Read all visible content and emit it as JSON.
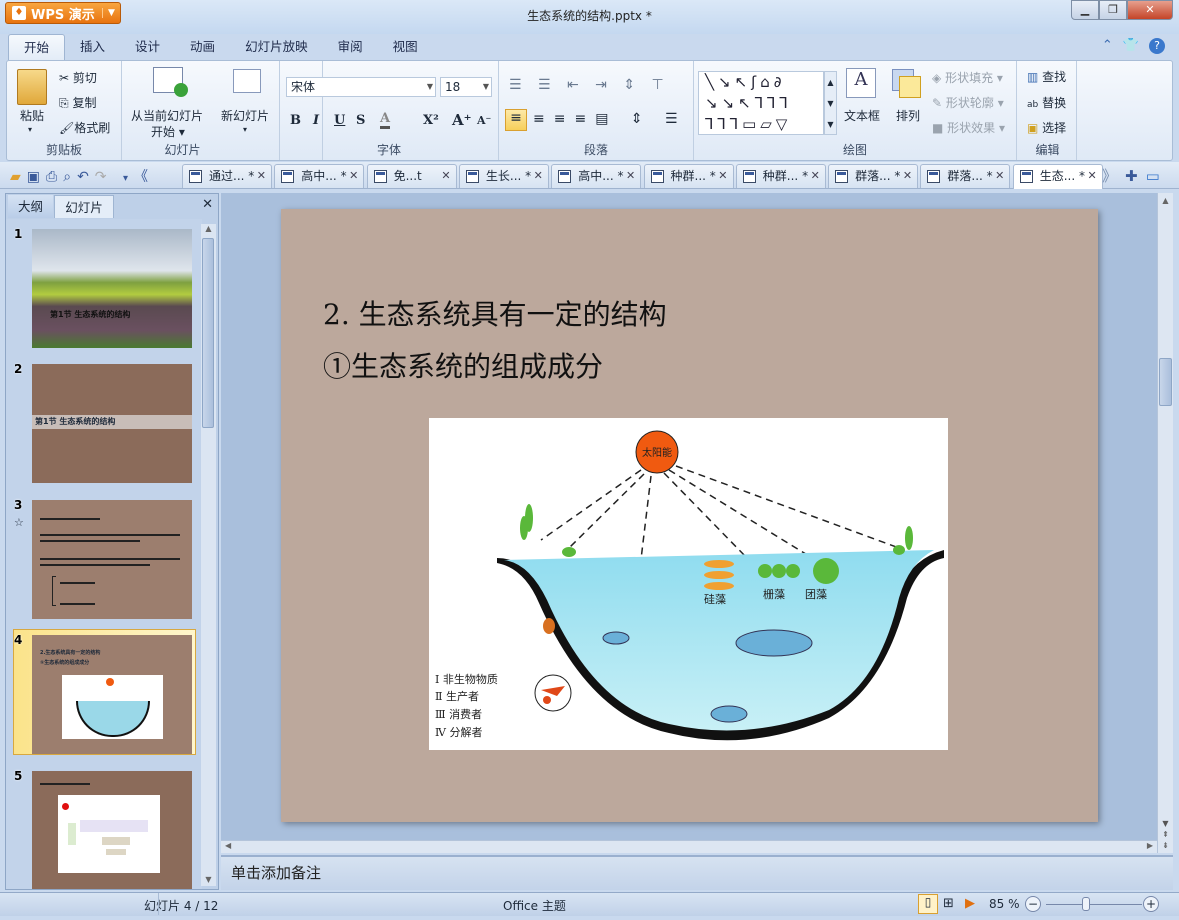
{
  "app": {
    "name": "WPS 演示",
    "doc_title": "生态系统的结构.pptx *"
  },
  "menu_tabs": [
    "开始",
    "插入",
    "设计",
    "动画",
    "幻灯片放映",
    "审阅",
    "视图"
  ],
  "ribbon": {
    "clipboard": {
      "label": "剪贴板",
      "paste": "粘贴",
      "cut": "剪切",
      "copy": "复制",
      "format_painter": "格式刷"
    },
    "slides": {
      "label": "幻灯片",
      "from_current_1": "从当前幻灯片",
      "from_current_2": "开始",
      "new_slide": "新幻灯片"
    },
    "font": {
      "label": "字体",
      "font_name": "宋体",
      "font_size": "18",
      "bold": "B",
      "italic": "I",
      "underline": "U",
      "strike": "S",
      "color": "A",
      "superscript": "X²",
      "grow": "A⁺",
      "shrink": "A⁻"
    },
    "paragraph": {
      "label": "段落"
    },
    "drawing": {
      "label": "绘图",
      "textbox": "文本框",
      "arrange": "排列",
      "shape_fill": "形状填充",
      "shape_outline": "形状轮廓",
      "shape_effect": "形状效果"
    },
    "edit": {
      "label": "编辑",
      "find": "查找",
      "replace": "替换",
      "select": "选择"
    }
  },
  "doc_tabs": [
    {
      "label": "通过...",
      "modified": "*"
    },
    {
      "label": "高中...",
      "modified": "*"
    },
    {
      "label": "免...t",
      "modified": ""
    },
    {
      "label": "生长...",
      "modified": "*"
    },
    {
      "label": "高中...",
      "modified": "*"
    },
    {
      "label": "种群...",
      "modified": "*"
    },
    {
      "label": "种群...",
      "modified": "*"
    },
    {
      "label": "群落...",
      "modified": "*"
    },
    {
      "label": "群落...",
      "modified": "*"
    },
    {
      "label": "生态...",
      "modified": "*",
      "active": true
    }
  ],
  "left_panel": {
    "tabs": [
      "大纲",
      "幻灯片"
    ],
    "active_tab": "幻灯片",
    "thumbnails": [
      {
        "num": "1",
        "title": "第1节 生态系统的结构"
      },
      {
        "num": "2",
        "title": "第1节  生态系统的结构"
      },
      {
        "num": "3",
        "title": ""
      },
      {
        "num": "4",
        "title": "2.生态系统具有一定的结构",
        "subtitle": "①生态系统的组成成分",
        "selected": true
      },
      {
        "num": "5",
        "title": ""
      }
    ]
  },
  "slide": {
    "title1": "2. 生态系统具有一定的结构",
    "title2": "①生态系统的组成成分",
    "figure": {
      "sun": "太阳能",
      "algae": [
        "硅藻",
        "栅藻",
        "团藻"
      ],
      "legend": [
        "Ⅰ 非生物物质",
        "Ⅱ 生产者",
        "Ⅲ 消费者",
        "Ⅳ 分解者"
      ]
    }
  },
  "notes_placeholder": "单击添加备注",
  "status": {
    "slide_pos": "幻灯片 4 / 12",
    "theme": "Office 主题",
    "zoom": "85 %",
    "zoom_percent": 85
  },
  "colors": {
    "slide_bg": "#bca89c",
    "wps_orange": "#f08a24",
    "sun": "#f05a10"
  }
}
